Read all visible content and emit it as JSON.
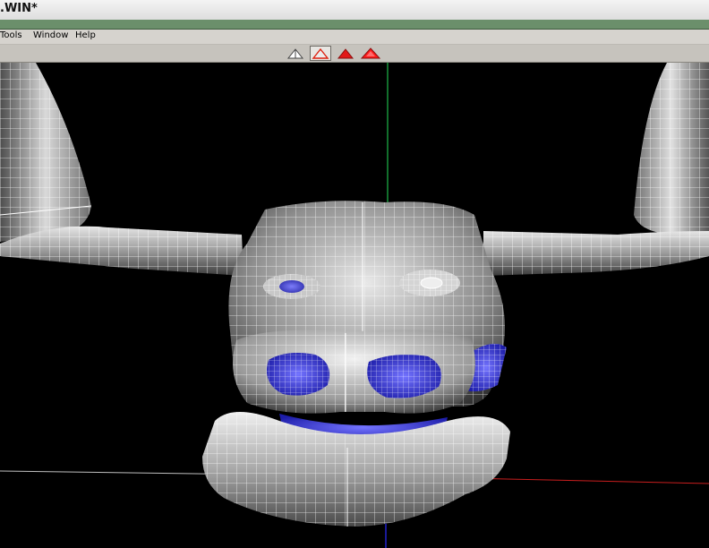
{
  "window": {
    "title": ".WIN*"
  },
  "menu": [
    {
      "label": "Tools"
    },
    {
      "label": "Window"
    },
    {
      "label": "Help"
    }
  ],
  "toolbar": {
    "buttons": [
      {
        "icon": "shade-wireframe-icon",
        "state": "normal"
      },
      {
        "icon": "shade-flat-icon",
        "state": "active"
      },
      {
        "icon": "shade-smooth-icon",
        "state": "normal"
      },
      {
        "icon": "shade-textured-icon",
        "state": "normal"
      }
    ]
  },
  "viewport": {
    "content": "3d-model-bull-head-wireframe-on-shaded",
    "background": "#000000",
    "wire_color": "#ffffff",
    "shade_color": "#a9a9a9",
    "selection_color": "#3a3ad0",
    "axis_colors": {
      "y": "#1fb84a",
      "x": "#c81e1e",
      "z": "#2c2cff",
      "ground": "#bfbfbf"
    }
  }
}
